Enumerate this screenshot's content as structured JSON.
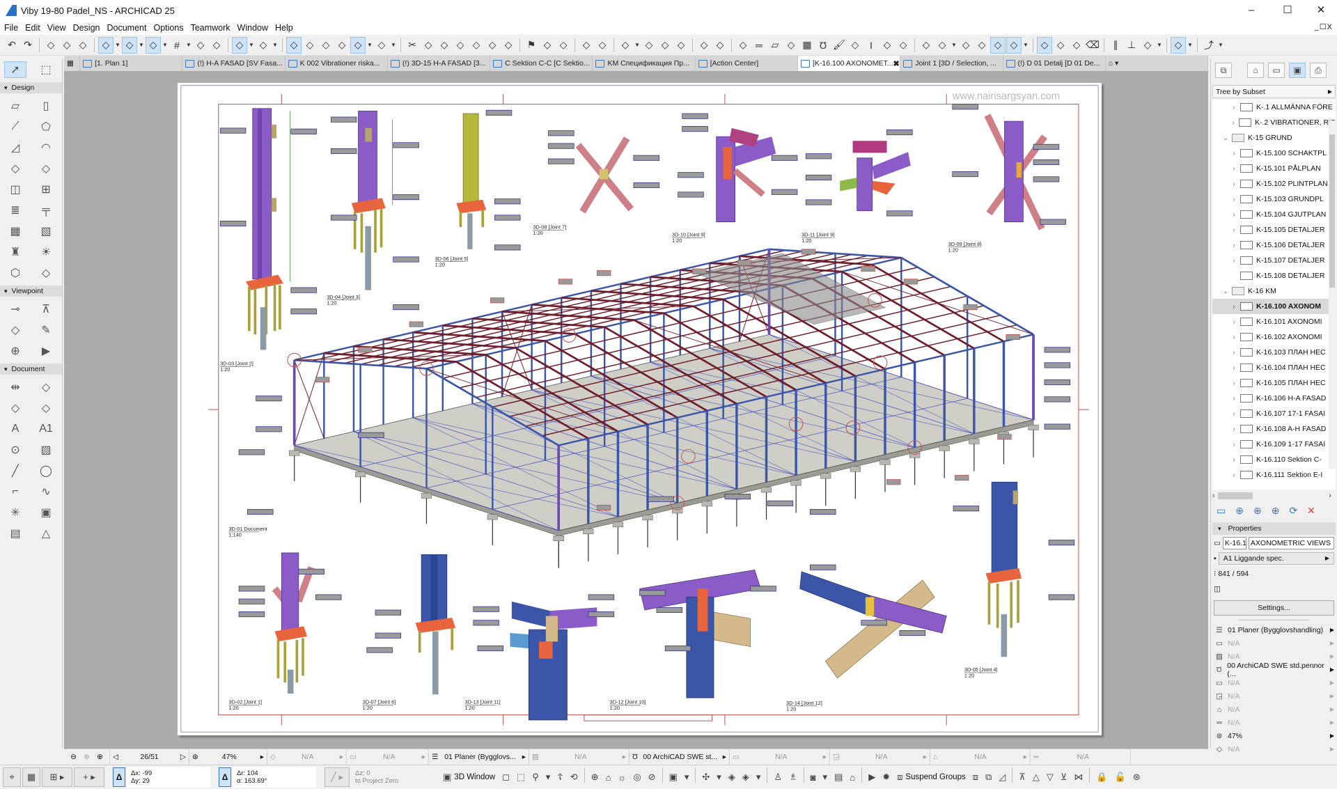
{
  "window": {
    "title": "Viby 19-80 Padel_NS - ARCHICAD 25",
    "minimize": "–",
    "maximize": "☐",
    "close": "✕",
    "mdi_controls": "_☐X"
  },
  "menu": [
    "File",
    "Edit",
    "View",
    "Design",
    "Document",
    "Options",
    "Teamwork",
    "Window",
    "Help"
  ],
  "toolbar_icons": [
    "undo",
    "redo",
    "sep",
    "find-select",
    "eyedropper",
    "syringe",
    "sep",
    "guide-line",
    "dd",
    "snap-guide",
    "dd",
    "coordinates",
    "dd",
    "grid",
    "dd",
    "edit-plane",
    "surface",
    "sep",
    "rectangle-select",
    "dd",
    "person",
    "dd",
    "sep",
    "trace",
    "ruler",
    "close-gap",
    "align",
    "magic-wand",
    "dd",
    "renovation",
    "dd",
    "sep",
    "split",
    "adjust",
    "intersect",
    "fillet",
    "offset",
    "resize",
    "roof-trim",
    "sep",
    "flag",
    "layout-note",
    "publish",
    "sep",
    "hotlink",
    "merge",
    "sep",
    "drawing",
    "dd",
    "sheet",
    "change-marker",
    "issue",
    "sep",
    "stair-tool",
    "railing",
    "sep",
    "wall-layers",
    "beam",
    "slab",
    "shell",
    "zone",
    "pen",
    "brush",
    "layout",
    "column",
    "mesh",
    "graphisoft",
    "sep",
    "close-cross",
    "grid-snap",
    "dd",
    "ruler-snap",
    "magic",
    "cursor-snap",
    "person2",
    "dd",
    "sep",
    "guide-angle",
    "line-guide",
    "pen-x",
    "eraser",
    "sep",
    "parallel",
    "perpendicular",
    "bisect",
    "dd",
    "sep",
    "snap-points",
    "dd",
    "sep",
    "curve",
    "dd"
  ],
  "tabs": [
    {
      "label": "[1. Plan 1]",
      "icon": "floor-plan-icon"
    },
    {
      "label": "(!) H-A FASAD  [SV Fasa...",
      "icon": "elevation-icon"
    },
    {
      "label": "K 002 Vibrationer riska...",
      "icon": "drawing-icon"
    },
    {
      "label": "(!) 3D-15 H-A FASAD [3...",
      "icon": "3d-document-icon"
    },
    {
      "label": "C Sektion C-C [C Sektio...",
      "icon": "section-icon"
    },
    {
      "label": "KM Спецификация Пр...",
      "icon": "schedule-icon"
    },
    {
      "label": "[Action Center]",
      "icon": "action-center-icon"
    },
    {
      "label": "[K-16.100 AXONOMET...",
      "icon": "layout-icon",
      "active": true,
      "close": "✖"
    },
    {
      "label": "Joint 1 [3D / Selection, ...",
      "icon": "3d-window-icon"
    },
    {
      "label": "(!) D 01 Detalj [D 01 De...",
      "icon": "detail-icon"
    }
  ],
  "toolbox": {
    "sections": [
      {
        "label": "Design",
        "tools": [
          "wall",
          "column",
          "beam",
          "slab",
          "roof",
          "shell",
          "skylight",
          "curtain-wall",
          "door",
          "window",
          "stair",
          "railing",
          "mesh",
          "zone",
          "object",
          "lamp",
          "morph",
          "wall-end"
        ]
      },
      {
        "label": "Viewpoint",
        "tools": [
          "section",
          "elevation",
          "interior-elevation",
          "worksheet",
          "detail",
          "camera"
        ]
      },
      {
        "label": "Document",
        "tools": [
          "dimension",
          "level-dimension",
          "radial-dimension",
          "angle-dimension",
          "text",
          "label",
          "marker",
          "fill",
          "line",
          "arc",
          "polyline",
          "spline",
          "hotspot",
          "figure",
          "drawing",
          "change"
        ]
      }
    ],
    "arrow_tool": "arrow-icon",
    "marquee_tool": "marquee-icon"
  },
  "drawing": {
    "watermark": "www.nairisargsyan.com",
    "views": [
      {
        "name": "3D-04 [Joint 3]",
        "scale": "1:20"
      },
      {
        "name": "3D-06 [Joint 5]",
        "scale": "1:20"
      },
      {
        "name": "3D-08 [Joint 7]",
        "scale": "1:20"
      },
      {
        "name": "3D-10 [Joint 9]",
        "scale": "1:20"
      },
      {
        "name": "3D-11 [Joint 9]",
        "scale": "1:20"
      },
      {
        "name": "3D-09 [Joint 8]",
        "scale": "1:20"
      },
      {
        "name": "3D-03 [Joint 2]",
        "scale": "1:20"
      },
      {
        "name": "3D-01 Document",
        "scale": "1:140"
      },
      {
        "name": "3D-02 [Joint 1]",
        "scale": "1:20"
      },
      {
        "name": "3D-07 [Joint 6]",
        "scale": "1:20"
      },
      {
        "name": "3D-13 [Joint 11]",
        "scale": "1:20"
      },
      {
        "name": "3D-12 [Joint 10]",
        "scale": "1:20"
      },
      {
        "name": "3D-14 [Joint 12]",
        "scale": "1:20"
      },
      {
        "name": "3D-05 [Joint 4]",
        "scale": "1:20"
      }
    ],
    "colors": {
      "column_purple": "#8b5cc8",
      "column_yellow": "#b5b83c",
      "column_blue": "#3b56a8",
      "beam_tan": "#d4b98a",
      "brace_pink": "#cf7f86",
      "rafter": "#6e1d2a",
      "border_red": "#c0504d",
      "plate_orange": "#e8643c"
    }
  },
  "navigator": {
    "top_icons": [
      "organizer-icon",
      "project-map-icon",
      "view-map-icon",
      "layout-book-icon",
      "publisher-icon"
    ],
    "tree_header": "Tree by Subset",
    "tree": [
      {
        "label": "K-.1 ALLMÄNNA FÖRE",
        "level": 1,
        "arrow": ">",
        "type": "layout"
      },
      {
        "label": "K-.2 VIBRATIONER, RIS",
        "level": 1,
        "arrow": ">",
        "type": "layout"
      },
      {
        "label": "K-15 GRUND",
        "level": 0,
        "arrow": "v",
        "type": "folder"
      },
      {
        "label": "K-15.100 SCHAKTPL",
        "level": 1,
        "arrow": ">",
        "type": "layout"
      },
      {
        "label": "K-15.101 PÅLPLAN",
        "level": 1,
        "arrow": ">",
        "type": "layout"
      },
      {
        "label": "K-15.102 PLINTPLAN",
        "level": 1,
        "arrow": ">",
        "type": "layout"
      },
      {
        "label": "K-15.103 GRUNDPL",
        "level": 1,
        "arrow": ">",
        "type": "layout"
      },
      {
        "label": "K-15.104 GJUTPLAN",
        "level": 1,
        "arrow": ">",
        "type": "layout"
      },
      {
        "label": "K-15.105 DETALJER",
        "level": 1,
        "arrow": ">",
        "type": "layout"
      },
      {
        "label": "K-15.106 DETALJER",
        "level": 1,
        "arrow": ">",
        "type": "layout"
      },
      {
        "label": "K-15.107 DETALJER",
        "level": 1,
        "arrow": ">",
        "type": "layout"
      },
      {
        "label": "K-15.108 DETALJER",
        "level": 1,
        "arrow": "",
        "type": "layout"
      },
      {
        "label": "K-16 KM",
        "level": 0,
        "arrow": "v",
        "type": "folder"
      },
      {
        "label": "K-16.100 AXONOM",
        "level": 1,
        "arrow": ">",
        "type": "layout",
        "selected": true
      },
      {
        "label": "K-16.101 AXONOMI",
        "level": 1,
        "arrow": ">",
        "type": "layout"
      },
      {
        "label": "K-16.102 AXONOMI",
        "level": 1,
        "arrow": ">",
        "type": "layout"
      },
      {
        "label": "K-16.103 ПЛАН НЕС",
        "level": 1,
        "arrow": ">",
        "type": "layout"
      },
      {
        "label": "K-16.104 ПЛАН НЕС",
        "level": 1,
        "arrow": ">",
        "type": "layout"
      },
      {
        "label": "K-16.105 ПЛАН НЕС",
        "level": 1,
        "arrow": ">",
        "type": "layout"
      },
      {
        "label": "K-16.106 H-A FASAD",
        "level": 1,
        "arrow": ">",
        "type": "layout"
      },
      {
        "label": "K-16.107 17-1 FASAI",
        "level": 1,
        "arrow": ">",
        "type": "layout"
      },
      {
        "label": "K-16.108 A-H FASAD",
        "level": 1,
        "arrow": ">",
        "type": "layout"
      },
      {
        "label": "K-16.109 1-17 FASAI",
        "level": 1,
        "arrow": ">",
        "type": "layout"
      },
      {
        "label": "K-16.110 Sektion C-",
        "level": 1,
        "arrow": ">",
        "type": "layout"
      },
      {
        "label": "K-16.111 Sektion E-I",
        "level": 1,
        "arrow": ">",
        "type": "layout"
      }
    ],
    "organizer_icons": [
      "layout-settings-icon",
      "new-layout-icon",
      "new-master-icon",
      "new-subset-icon",
      "update-icon",
      "delete-icon"
    ],
    "properties": {
      "header": "Properties",
      "id": "K-16.1(",
      "name": "AXONOMETRIC VIEWS",
      "master": "A1 Liggande spec.",
      "size": "841 / 594",
      "settings_button": "Settings..."
    },
    "view_props": [
      {
        "icon": "layers-icon",
        "label": "01 Planer (Bygglovshandling)",
        "enabled": true
      },
      {
        "icon": "scale-icon",
        "label": "N/A",
        "enabled": false
      },
      {
        "icon": "structure-icon",
        "label": "N/A",
        "enabled": false
      },
      {
        "icon": "pen-set-icon",
        "label": "00 ArchiCAD SWE std.pennor (...",
        "enabled": true
      },
      {
        "icon": "model-view-icon",
        "label": "N/A",
        "enabled": false
      },
      {
        "icon": "graphic-override-icon",
        "label": "N/A",
        "enabled": false
      },
      {
        "icon": "renovation-icon",
        "label": "N/A",
        "enabled": false
      },
      {
        "icon": "dimension-icon",
        "label": "N/A",
        "enabled": false
      },
      {
        "icon": "zoom-icon",
        "label": "47%",
        "enabled": true
      },
      {
        "icon": "rotation-icon",
        "label": "N/A",
        "enabled": false
      }
    ]
  },
  "statusbar": {
    "page": "26/51",
    "zoom": "47%",
    "rotation": "N/A",
    "scale": "N/A",
    "layers": "01 Planer (Bygglovs...",
    "structure": "N/A",
    "pen_set": "00 ArchiCAD SWE st...",
    "model_view": "N/A",
    "override": "N/A",
    "renovation": "N/A",
    "dimension": "N/A"
  },
  "coords": {
    "dx": "Δx: -99",
    "dy": "Δy: 29",
    "dr": "Δr: 104",
    "angle": "α: 163.69°",
    "dz": "Δz: 0",
    "ref": "to Project Zero"
  },
  "bottom_buttons": {
    "window3d": "3D Window",
    "suspend_groups": "Suspend Groups"
  }
}
